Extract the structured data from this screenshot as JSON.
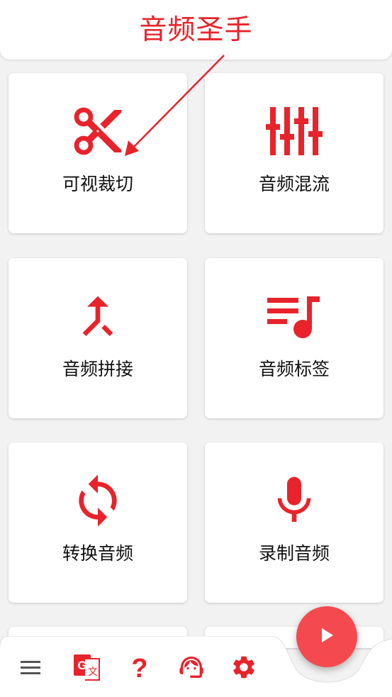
{
  "app": {
    "title": "音频圣手"
  },
  "colors": {
    "accent": "#e8232b",
    "fab": "#f44a4f",
    "background": "#f2f2f2"
  },
  "cards": [
    {
      "label": "可视裁切",
      "icon": "scissors-icon"
    },
    {
      "label": "音频混流",
      "icon": "equalizer-icon"
    },
    {
      "label": "音频拼接",
      "icon": "merge-icon"
    },
    {
      "label": "音频标签",
      "icon": "playlist-music-icon"
    },
    {
      "label": "转换音频",
      "icon": "sync-icon"
    },
    {
      "label": "录制音频",
      "icon": "microphone-icon"
    }
  ],
  "bottom_nav": [
    {
      "icon": "menu-icon"
    },
    {
      "icon": "translate-icon"
    },
    {
      "icon": "help-icon"
    },
    {
      "icon": "support-agent-icon"
    },
    {
      "icon": "settings-icon"
    }
  ],
  "fab": {
    "icon": "play-icon"
  }
}
